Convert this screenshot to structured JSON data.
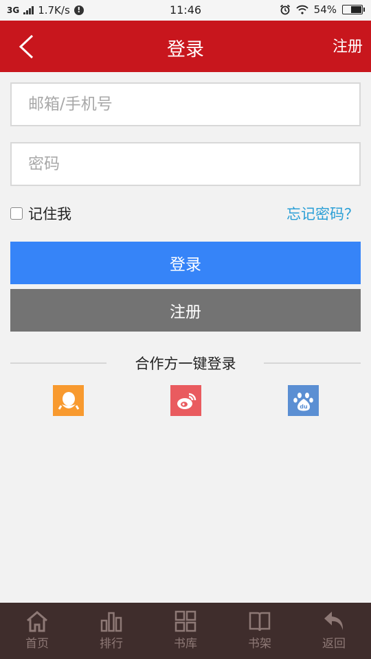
{
  "status_bar": {
    "network": "3G",
    "speed": "1.7K/s",
    "time": "11:46",
    "battery": "54%",
    "battery_level": 0.54
  },
  "header": {
    "title": "登录",
    "register_link": "注册"
  },
  "form": {
    "email_placeholder": "邮箱/手机号",
    "password_placeholder": "密码",
    "remember_label": "记住我",
    "forgot_label": "忘记密码？",
    "login_button": "登录",
    "register_button": "注册"
  },
  "partner": {
    "label": "合作方一键登录",
    "providers": [
      "qq",
      "weibo",
      "baidu"
    ]
  },
  "bottom_nav": {
    "items": [
      {
        "label": "首页",
        "icon": "home-icon"
      },
      {
        "label": "排行",
        "icon": "ranking-icon"
      },
      {
        "label": "书库",
        "icon": "library-icon"
      },
      {
        "label": "书架",
        "icon": "bookshelf-icon"
      },
      {
        "label": "返回",
        "icon": "return-icon"
      }
    ]
  },
  "colors": {
    "header": "#c8161d",
    "login_button": "#3684f8",
    "register_button": "#737373",
    "link": "#2a9fd6",
    "bottom_nav": "#3f2d2c",
    "qq": "#f89a2f",
    "weibo": "#e95b5f",
    "baidu": "#5b8fd3"
  }
}
